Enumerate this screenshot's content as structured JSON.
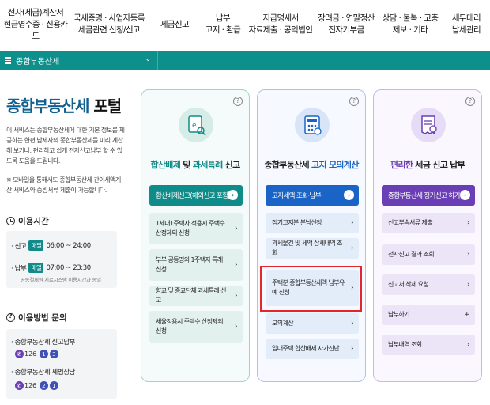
{
  "nav": [
    {
      "line1": "전자(세금)계산서",
      "line2": "현금영수증 · 신용카드"
    },
    {
      "line1": "국세증명 · 사업자등록",
      "line2": "세금관련 신청/신고"
    },
    {
      "line1": "세금신고",
      "line2": ""
    },
    {
      "line1": "납부",
      "line2": "고지 · 환급"
    },
    {
      "line1": "지급명세서",
      "line2": "자료제출 · 공익법인"
    },
    {
      "line1": "장려금 · 연말정산",
      "line2": "전자기부금"
    },
    {
      "line1": "상담 · 불복 · 고충",
      "line2": "제보 · 기타"
    },
    {
      "line1": "세무대리",
      "line2": "납세관리"
    }
  ],
  "menubar": {
    "selected": "종합부동산세",
    "chevron": "⌄"
  },
  "page": {
    "title_part1": "종합부동산세",
    "title_part2": " 포털",
    "desc1": "이 서비스는 종합부동산세에 대한 기본 정보를 제공하는 한편 납세자의 종합부동산세를 미리 계산해 보거나, 편리하고 쉽게 전자신고납부 할 수 있도록 도움을 드립니다.",
    "desc2": "※ 모바일을 통해서도 종합부동산세 간이세액계산 서비스와 증빙서류 제출이 가능합니다."
  },
  "hours": {
    "heading": "이용시간",
    "rows": [
      {
        "label": "· 신고",
        "tag": "매일",
        "time": "06:00 ~ 24:00"
      },
      {
        "label": "· 납부",
        "tag": "매일",
        "time": "07:00 ~ 23:30"
      }
    ],
    "note": "공동결제원 지로시스템 이용시간과 동일"
  },
  "inquiry": {
    "heading": "이용방법 문의",
    "items": [
      {
        "label": "· 종합부동산세 신고납부",
        "phone": "126",
        "d1": "1",
        "d2": "3"
      },
      {
        "label": "· 종합부동산세 세법상담",
        "phone": "126",
        "d1": "2",
        "d2": "1"
      }
    ]
  },
  "cards": [
    {
      "title_hl1": "합산배제",
      "title_mid": " 및 ",
      "title_hl2": "과세특례",
      "title_end": " 신고",
      "primary": "합산배제신고(해외신고 포함)",
      "items": [
        "1세대1주택자 적용시 주택수 산정제외 신청",
        "부부 공동명의 1주택자 특례 신청",
        "향교 및 종교단체 과세특례 신고",
        "세율적용시 주택수 산정제외 신청"
      ]
    },
    {
      "title_pre": "종합부동산세 ",
      "title_hl": "고지 모의계산",
      "primary": "고지세액 조회·납부",
      "items": [
        "정기고지분 분납신청",
        "과세물건 및 세액 상세내역 조회",
        "주택분 종합부동산세액 납부유예 신청",
        "모의계산",
        "임대주택 합산배제 자가진단"
      ]
    },
    {
      "title_hl": "편리한",
      "title_end": " 세금 신고 납부",
      "primary": "종합부동산세 정기신고 하기",
      "items": [
        "신고부속서류 제출",
        "전자신고 결과 조회",
        "신고서 삭제 요청",
        "납부하기",
        "납부내역 조회"
      ]
    }
  ],
  "help_glyph": "?",
  "arrow_glyph": "›",
  "plus_glyph": "+",
  "go_glyph": "›"
}
